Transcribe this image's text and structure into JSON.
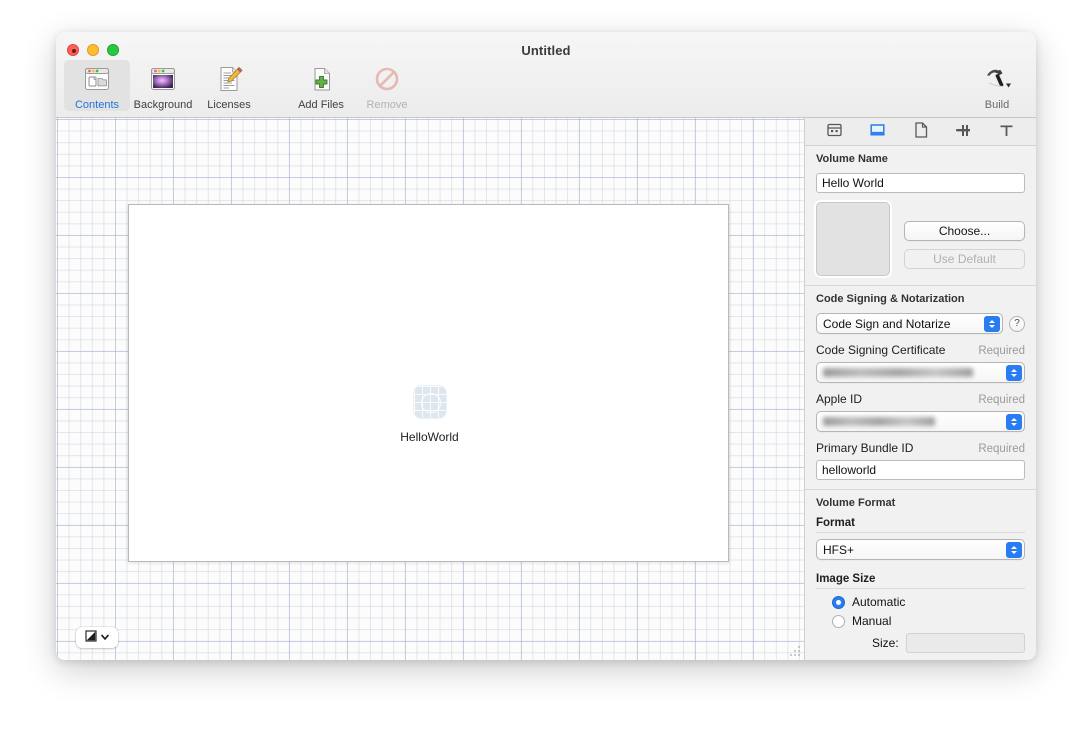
{
  "window": {
    "title": "Untitled",
    "traffic_lights": [
      "close",
      "minimize",
      "maximize"
    ]
  },
  "toolbar": {
    "items": [
      {
        "label": "Contents",
        "icon": "contents-window-icon",
        "selected": true,
        "enabled": true
      },
      {
        "label": "Background",
        "icon": "background-window-icon",
        "selected": false,
        "enabled": true
      },
      {
        "label": "Licenses",
        "icon": "licenses-document-pencil-icon",
        "selected": false,
        "enabled": true
      },
      {
        "label": "Add Files",
        "icon": "add-files-document-plus-icon",
        "selected": false,
        "enabled": true
      },
      {
        "label": "Remove",
        "icon": "remove-prohibition-icon",
        "selected": false,
        "enabled": false
      }
    ],
    "build": {
      "label": "Build",
      "icon": "hammer-icon",
      "has_dropdown": true
    }
  },
  "canvas": {
    "volume_item": {
      "label": "HelloWorld",
      "icon": "app-placeholder-icon"
    },
    "view_style_button": {
      "icon": "view-style-icon",
      "chevron": "chevron-down-icon"
    }
  },
  "inspector": {
    "tabs": [
      {
        "name": "window-settings-tab",
        "icon": "window-grid-icon",
        "selected": false
      },
      {
        "name": "volume-tab",
        "icon": "disk-volume-icon",
        "selected": true
      },
      {
        "name": "document-tab",
        "icon": "document-icon",
        "selected": false
      },
      {
        "name": "connections-tab",
        "icon": "plug-icon",
        "selected": false
      },
      {
        "name": "text-tab",
        "icon": "text-t-icon",
        "selected": false
      }
    ],
    "volume_name": {
      "section_title": "Volume Name",
      "value": "Hello World",
      "choose_label": "Choose...",
      "use_default_label": "Use Default",
      "use_default_enabled": false
    },
    "code_signing": {
      "section_title": "Code Signing & Notarization",
      "mode_value": "Code Sign and Notarize",
      "help_label": "?",
      "certificate_label": "Code Signing Certificate",
      "certificate_required": "Required",
      "certificate_value": "",
      "certificate_redacted": true,
      "apple_id_label": "Apple ID",
      "apple_id_required": "Required",
      "apple_id_value": "",
      "apple_id_redacted": true,
      "bundle_id_label": "Primary Bundle ID",
      "bundle_id_required": "Required",
      "bundle_id_value": "helloworld"
    },
    "volume_format": {
      "section_title": "Volume Format",
      "format_label": "Format",
      "format_value": "HFS+"
    },
    "image_size": {
      "section_title": "Image Size",
      "options": [
        {
          "label": "Automatic",
          "selected": true
        },
        {
          "label": "Manual",
          "selected": false
        }
      ],
      "size_label": "Size:",
      "size_value": "",
      "size_enabled": false
    }
  },
  "colors": {
    "accent_blue": "#2a7cf2",
    "selected_tab_text": "#2274d8",
    "disabled_text": "#b0b0b0"
  }
}
